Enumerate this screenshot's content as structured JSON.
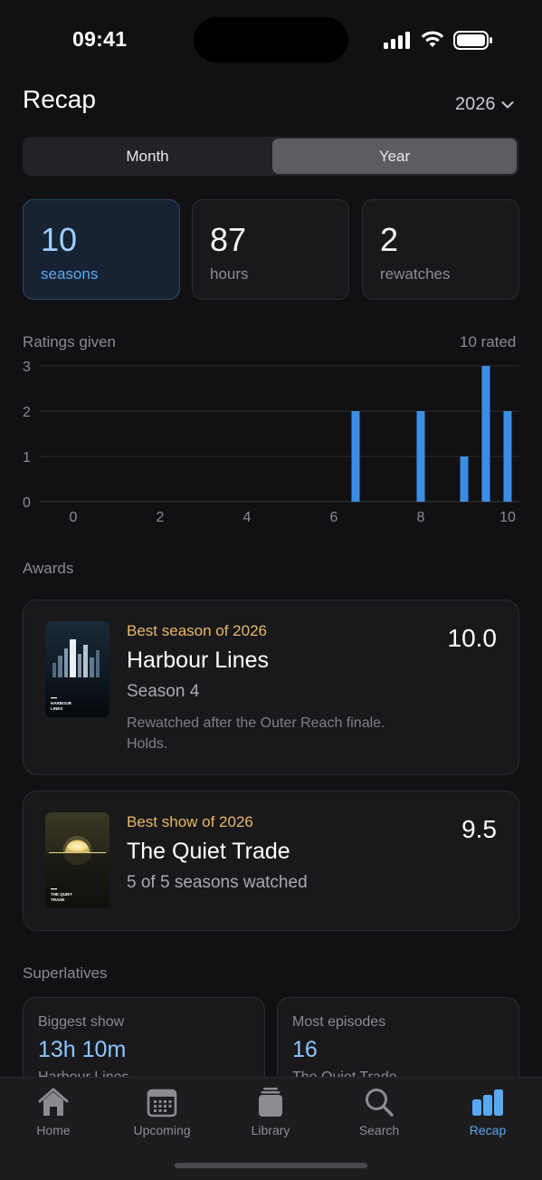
{
  "status": {
    "time": "09:41"
  },
  "header": {
    "title": "Recap",
    "year": "2026"
  },
  "segmented": {
    "options": [
      "Month",
      "Year"
    ],
    "selected": "Year"
  },
  "stats": [
    {
      "value": "10",
      "label": "seasons",
      "active": true
    },
    {
      "value": "87",
      "label": "hours",
      "active": false
    },
    {
      "value": "2",
      "label": "rewatches",
      "active": false
    }
  ],
  "ratings": {
    "label": "Ratings given",
    "count_label": "10 rated"
  },
  "chart_data": {
    "type": "bar",
    "title": "Ratings given",
    "xlabel": "",
    "ylabel": "",
    "x": [
      6.5,
      8,
      9,
      9.5,
      10
    ],
    "values": [
      2,
      2,
      1,
      3,
      2
    ],
    "xlim": [
      0,
      10
    ],
    "ylim": [
      0,
      3
    ],
    "x_ticks": [
      "0",
      "2",
      "4",
      "6",
      "8",
      "10"
    ],
    "y_ticks": [
      "0",
      "1",
      "2",
      "3"
    ],
    "grid": true,
    "bar_color": "#3b8ee5"
  },
  "awards": {
    "section_title": "Awards",
    "items": [
      {
        "kicker": "Best season of 2026",
        "title": "Harbour Lines",
        "subtitle": "Season 4",
        "note": "Rewatched after the Outer Reach finale. Holds.",
        "score": "10.0",
        "poster_text": "HARBOUR LINES"
      },
      {
        "kicker": "Best show of 2026",
        "title": "The Quiet Trade",
        "subtitle": "5 of 5 seasons watched",
        "score": "9.5",
        "poster_text": "THE QUIET TRADE"
      }
    ]
  },
  "superlatives": {
    "section_title": "Superlatives",
    "items": [
      {
        "label": "Biggest show",
        "value": "13h 10m",
        "sub": "Harbour Lines"
      },
      {
        "label": "Most episodes",
        "value": "16",
        "sub": "The Quiet Trade"
      }
    ]
  },
  "tabs": [
    {
      "label": "Home",
      "icon": "home-icon",
      "active": false
    },
    {
      "label": "Upcoming",
      "icon": "calendar-icon",
      "active": false
    },
    {
      "label": "Library",
      "icon": "library-icon",
      "active": false
    },
    {
      "label": "Search",
      "icon": "search-icon",
      "active": false
    },
    {
      "label": "Recap",
      "icon": "recap-icon",
      "active": true
    }
  ],
  "colors": {
    "accent": "#5aa8f0",
    "award_kicker": "#e9b766",
    "bar": "#3b8ee5"
  }
}
